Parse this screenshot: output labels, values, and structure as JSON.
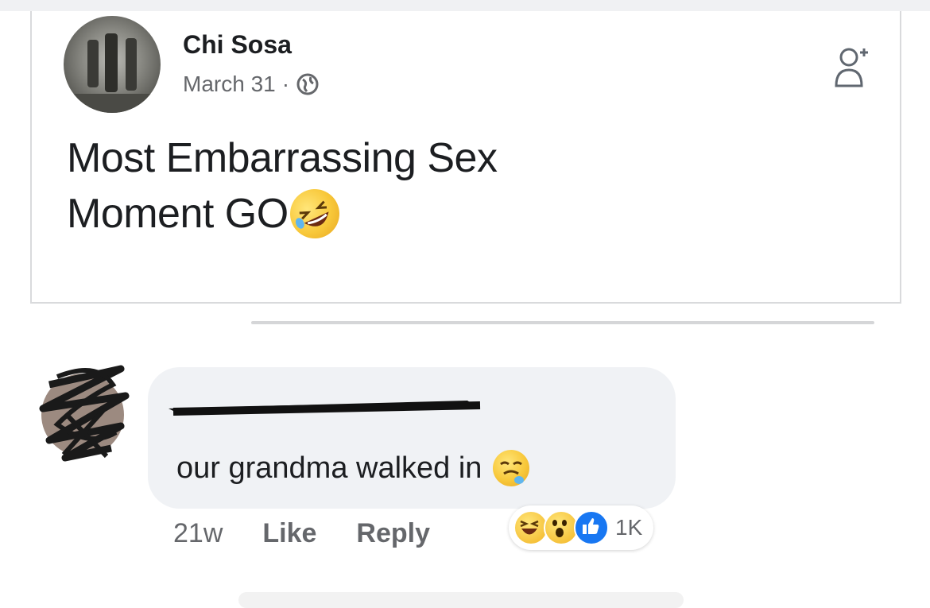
{
  "post": {
    "author": "Chi Sosa",
    "date": "March 31",
    "separator": "·",
    "privacy_icon": "globe-icon",
    "text_line1": "Most Embarrassing Sex",
    "text_line2": "Moment GO",
    "text_emoji": "rolling-on-floor-laughing-emoji",
    "action_icon": "add-friend-icon"
  },
  "comment": {
    "author_redacted": true,
    "text": "our grandma walked in",
    "text_emoji": "crying-laughing-emoji",
    "time": "21w",
    "like_label": "Like",
    "reply_label": "Reply",
    "reactions": [
      "haha-reaction-icon",
      "wow-reaction-icon",
      "like-reaction-icon"
    ],
    "reaction_count": "1K"
  },
  "colors": {
    "text": "#1c1e21",
    "muted": "#65676b",
    "bubble": "#f0f2f5",
    "like_blue": "#1877f2"
  }
}
